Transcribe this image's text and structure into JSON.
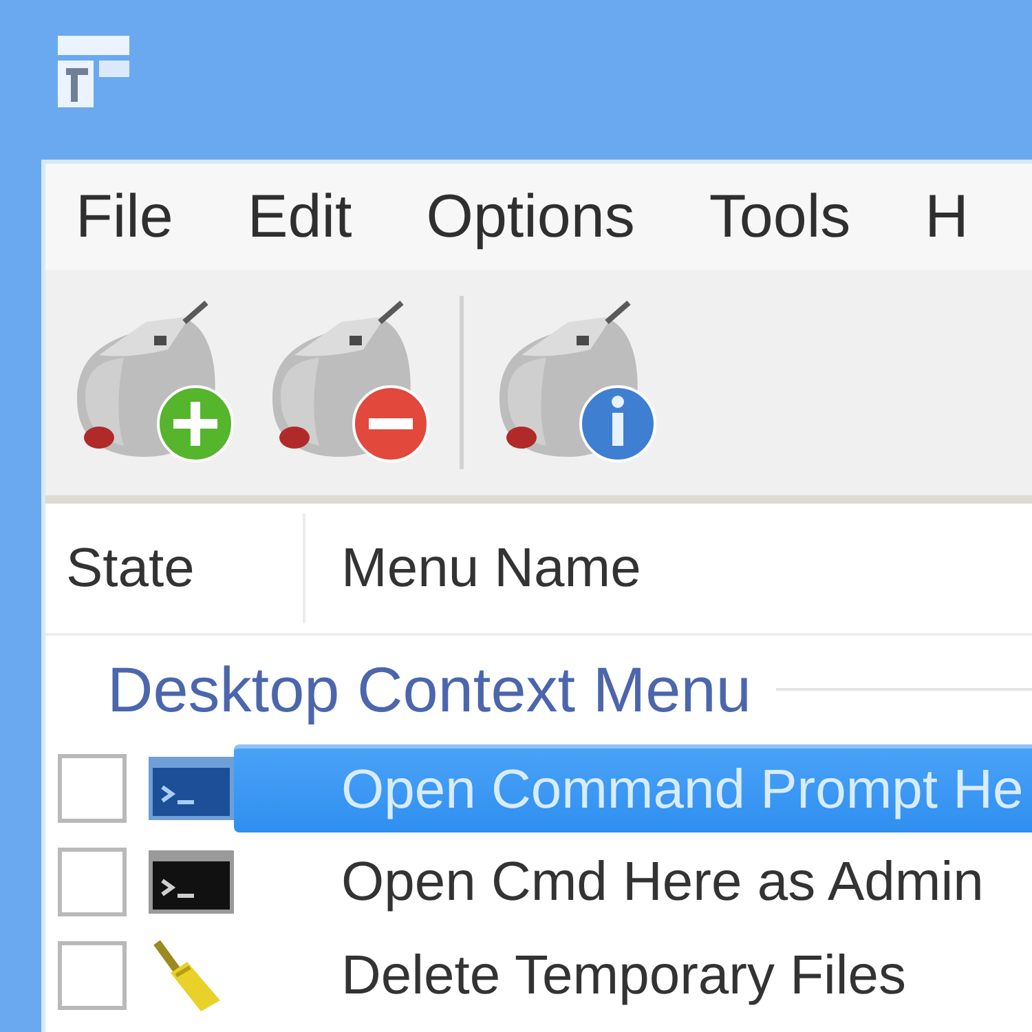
{
  "menu_bar": [
    "File",
    "Edit",
    "Options",
    "Tools",
    "H"
  ],
  "toolbar": [
    {
      "kind": "add"
    },
    {
      "kind": "remove"
    },
    {
      "kind": "separator"
    },
    {
      "kind": "info"
    }
  ],
  "table": {
    "columns": [
      "State",
      "Menu Name"
    ],
    "groups": [
      {
        "label": "Desktop Context Menu",
        "rows": [
          {
            "checked": false,
            "selected": true,
            "kind": "terminal",
            "name": "Open Command Prompt He"
          },
          {
            "checked": false,
            "selected": false,
            "kind": "terminal",
            "name": "Open Cmd Here as Admin"
          },
          {
            "checked": false,
            "selected": false,
            "kind": "brush",
            "name": "Delete Temporary Files"
          }
        ]
      }
    ]
  }
}
